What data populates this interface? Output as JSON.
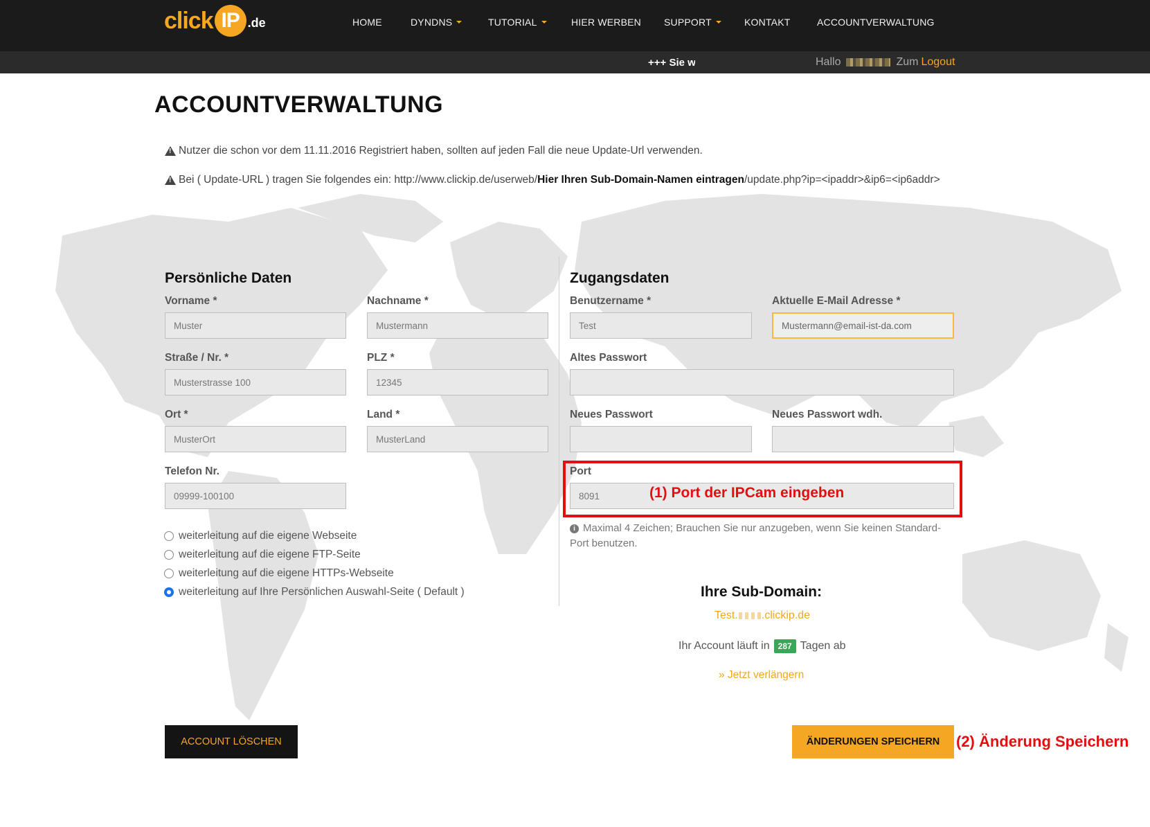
{
  "logo": {
    "part1": "click",
    "part2": "IP",
    "part3": ".de"
  },
  "nav": {
    "home": "HOME",
    "dyndns": "DYNDNS",
    "tutorial": "TUTORIAL",
    "hier_werben": "HIER WERBEN",
    "support": "SUPPORT",
    "kontakt": "KONTAKT",
    "accountverwaltung": "ACCOUNTVERWALTUNG"
  },
  "subbar": {
    "ticker": "+++ Sie w",
    "hallo": "Hallo",
    "zum": "Zum",
    "logout": "Logout"
  },
  "page_title": "ACCOUNTVERWALTUNG",
  "notices": {
    "n1": "Nutzer die schon vor dem 11.11.2016 Registriert haben, sollten auf jeden Fall die neue Update-Url verwenden.",
    "n2_pre": "Bei ( Update-URL ) tragen Sie folgendes ein: http://www.clickip.de/userweb/",
    "n2_bold": "Hier Ihren Sub-Domain-Namen eintragen",
    "n2_post": "/update.php?ip=<ipaddr>&ip6=<ip6addr>"
  },
  "personal": {
    "title": "Persönliche Daten",
    "vorname_label": "Vorname *",
    "vorname": "Muster",
    "nachname_label": "Nachname *",
    "nachname": "Mustermann",
    "strasse_label": "Straße / Nr. *",
    "strasse": "Musterstrasse 100",
    "plz_label": "PLZ *",
    "plz": "12345",
    "ort_label": "Ort *",
    "ort": "MusterOrt",
    "land_label": "Land *",
    "land": "MusterLand",
    "telefon_label": "Telefon Nr.",
    "telefon": "09999-100100"
  },
  "redirect_options": [
    {
      "label": "weiterleitung auf die eigene Webseite",
      "checked": false
    },
    {
      "label": "weiterleitung auf die eigene FTP-Seite",
      "checked": false
    },
    {
      "label": "weiterleitung auf die eigene HTTPs-Webseite",
      "checked": false
    },
    {
      "label": "weiterleitung auf Ihre Persönlichen Auswahl-Seite ( Default )",
      "checked": true
    }
  ],
  "access": {
    "title": "Zugangsdaten",
    "username_label": "Benutzername *",
    "username": "Test",
    "email_label": "Aktuelle E-Mail Adresse *",
    "email": "Mustermann@email-ist-da.com",
    "old_pw_label": "Altes Passwort",
    "old_pw": "",
    "new_pw_label": "Neues Passwort",
    "new_pw": "",
    "new_pw2_label": "Neues Passwort wdh.",
    "new_pw2": "",
    "port_label": "Port",
    "port": "8091",
    "port_hint": "Maximal 4 Zeichen; Brauchen Sie nur anzugeben, wenn Sie keinen Standard-Port benutzen."
  },
  "annotations": {
    "a1": "(1) Port der IPCam eingeben",
    "a2": "(2) Änderung Speichern"
  },
  "subdomain": {
    "title": "Ihre Sub-Domain:",
    "prefix": "Test.",
    "suffix": ".clickip.de",
    "expire_pre": "Ihr Account läuft in",
    "days": "287",
    "expire_post": "Tagen ab",
    "renew": "» Jetzt verlängern"
  },
  "buttons": {
    "delete": "ACCOUNT LÖSCHEN",
    "save": "ÄNDERUNGEN SPEICHERN"
  },
  "colors": {
    "accent": "#f5a623",
    "header_bg": "#1b1b1b",
    "annotation_red": "#e01010",
    "badge_green": "#3aa657"
  }
}
